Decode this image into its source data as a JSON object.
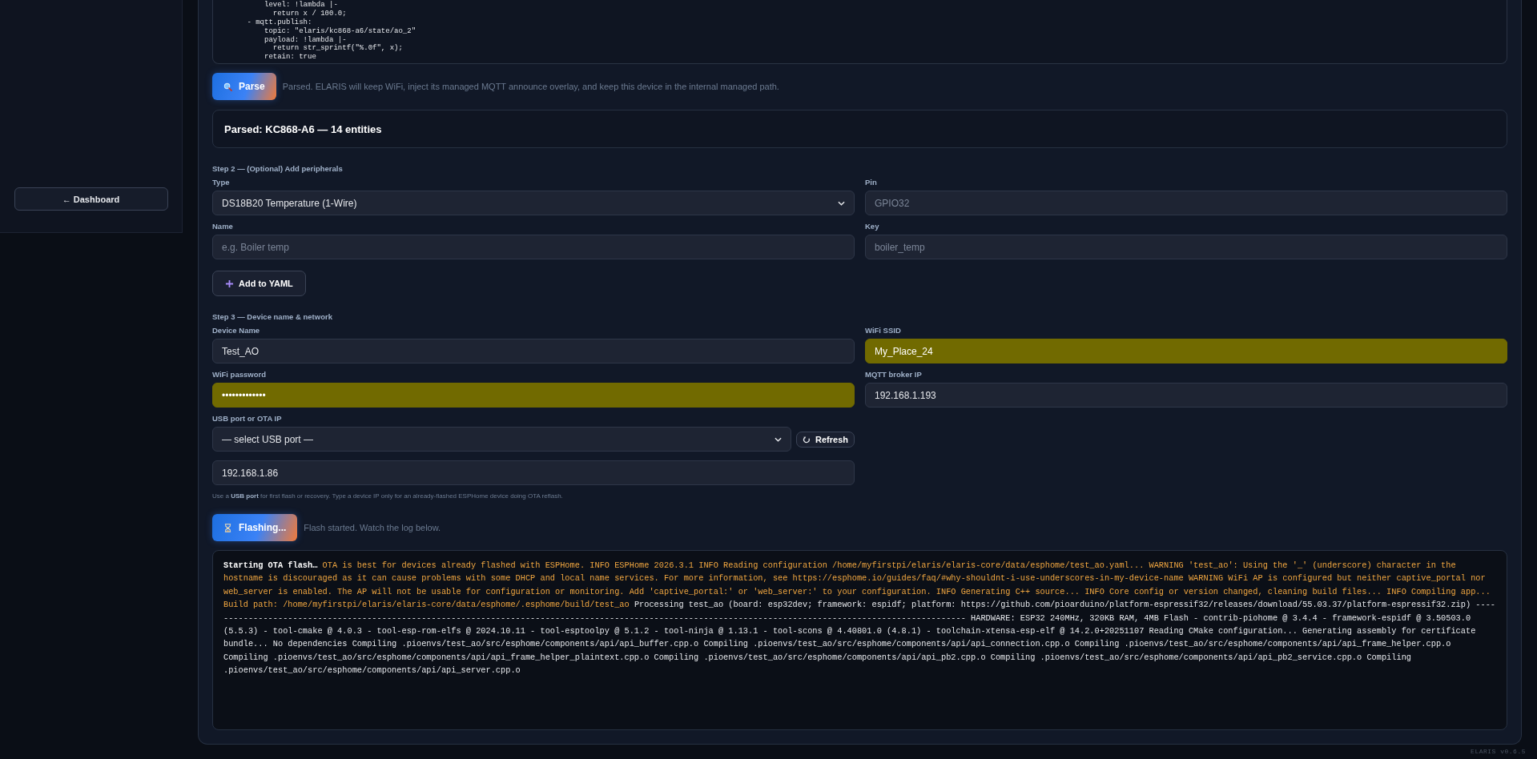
{
  "sidebar": {
    "back_button": "← Dashboard"
  },
  "yaml_editor": {
    "value": "          level: !lambda |-\n            return x / 100.0;\n      - mqtt.publish:\n          topic: \"elaris/kc868-a6/state/ao_2\"\n          payload: !lambda |-\n            return str_sprintf(\"%.0f\", x);\n          retain: true"
  },
  "parse": {
    "button": "Parse",
    "message": "Parsed. ELARIS will keep WiFi, inject its managed MQTT announce overlay, and keep this device in the internal managed path."
  },
  "parsed_summary": "Parsed: KC868-A6 — 14 entities",
  "step2": {
    "heading": "Step 2 — (Optional) Add peripherals",
    "fields": [
      {
        "label": "Type",
        "kind": "select",
        "value": "DS18B20 Temperature (1-Wire)",
        "autofilled": false
      },
      {
        "label": "Pin",
        "kind": "input",
        "placeholder": "GPIO32",
        "autofilled": false
      },
      {
        "label": "Name",
        "kind": "input",
        "placeholder": "e.g. Boiler temp",
        "autofilled": false
      },
      {
        "label": "Key",
        "kind": "input",
        "placeholder": "boiler_temp",
        "autofilled": false
      }
    ],
    "add_button": "Add to YAML"
  },
  "step3": {
    "heading": "Step 3 — Device name & network",
    "fields": [
      {
        "label": "Device Name",
        "kind": "input",
        "value": "Test_AO",
        "autofilled": false
      },
      {
        "label": "WiFi SSID",
        "kind": "input",
        "value": "My_Place_24",
        "autofilled": true
      },
      {
        "label": "WiFi password",
        "kind": "input",
        "value": "•••••••••••••",
        "autofilled": true
      },
      {
        "label": "MQTT broker IP",
        "kind": "input",
        "value": "192.168.1.193",
        "autofilled": false
      }
    ],
    "port": {
      "label": "USB port or OTA IP",
      "select_value": "— select USB port —",
      "refresh_button": "Refresh",
      "ip_value": "192.168.1.86"
    },
    "hint": "Use a **USB port** for first flash or recovery. Type a device IP only for an already-flashed ESPHome device doing OTA reflash."
  },
  "flash": {
    "button": "Flashing...",
    "message": "Flash started. Watch the log below."
  },
  "log": [
    {
      "kind": "start",
      "text": "Starting OTA flash… "
    },
    {
      "kind": "warn",
      "text": "OTA is best for devices already flashed with ESPHome. INFO ESPHome 2026.3.1 INFO Reading configuration /home/myfirstpi/elaris/elaris-core/data/esphome/test_ao.yaml... WARNING 'test_ao': Using the '_' (underscore) character in the hostname is discouraged as it can cause problems with some DHCP and local name services. For more information, see https://esphome.io/guides/faq/#why-shouldnt-i-use-underscores-in-my-device-name WARNING WiFi AP is configured but neither captive_portal nor web_server is enabled. The AP will not be usable for configuration or monitoring. Add 'captive_portal:' or 'web_server:' to your configuration. INFO Generating C++ source... INFO Core config or version changed, cleaning build files... INFO Compiling app... Build path: /home/myfirstpi/elaris/elaris-core/data/esphome/.esphome/build/test_ao"
    },
    {
      "kind": "info",
      "text": " Processing test_ao (board: esp32dev; framework: espidf; platform: https://github.com/pioarduino/platform-espressif32/releases/download/55.03.37/platform-espressif32.zip) ---------------------------------------------------------------------------------------------------------------------------------------------------------- HARDWARE: ESP32 240MHz, 320KB RAM, 4MB Flash - contrib-piohome @ 3.4.4 - framework-espidf @ 3.50503.0 (5.5.3) - tool-cmake @ 4.0.3 - tool-esp-rom-elfs @ 2024.10.11 - tool-esptoolpy @ 5.1.2 - tool-ninja @ 1.13.1 - tool-scons @ 4.40801.0 (4.8.1) - toolchain-xtensa-esp-elf @ 14.2.0+20251107 Reading CMake configuration... Generating assembly for certificate bundle... No dependencies Compiling .pioenvs/test_ao/src/esphome/components/api/api_buffer.cpp.o Compiling .pioenvs/test_ao/src/esphome/components/api/api_connection.cpp.o Compiling .pioenvs/test_ao/src/esphome/components/api/api_frame_helper.cpp.o Compiling .pioenvs/test_ao/src/esphome/components/api/api_frame_helper_plaintext.cpp.o Compiling .pioenvs/test_ao/src/esphome/components/api/api_pb2.cpp.o Compiling .pioenvs/test_ao/src/esphome/components/api/api_pb2_service.cpp.o Compiling .pioenvs/test_ao/src/esphome/components/api/api_server.cpp.o"
    }
  ],
  "version": "ELARIS v0.6.5"
}
